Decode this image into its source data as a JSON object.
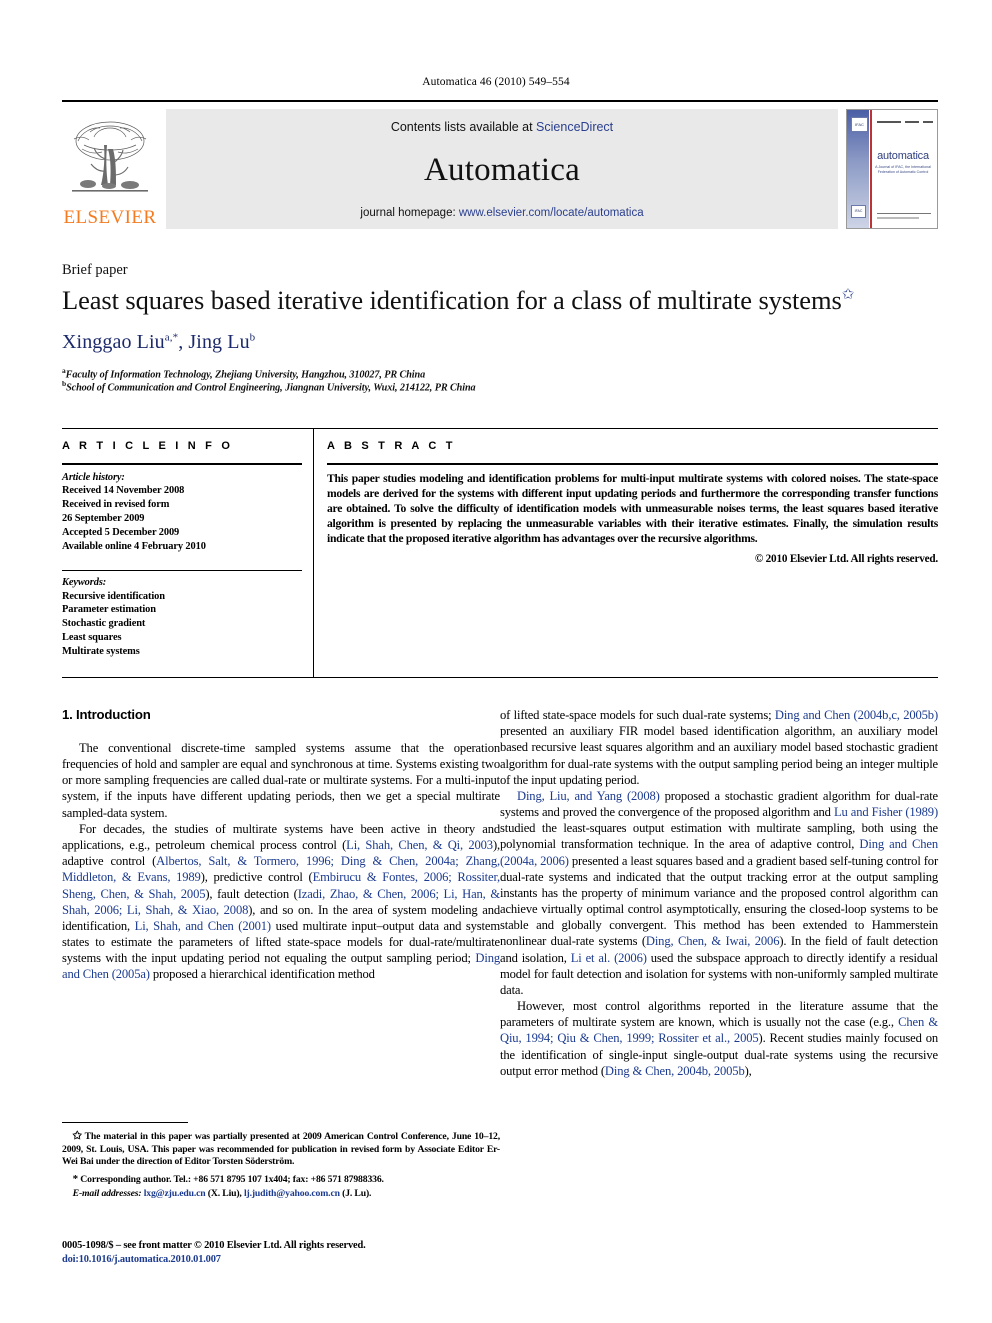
{
  "running_head": "Automatica 46 (2010) 549–554",
  "masthead": {
    "contents_prefix": "Contents lists available at ",
    "contents_link": "ScienceDirect",
    "journal_name": "Automatica",
    "homepage_prefix": "journal homepage: ",
    "homepage_link": "www.elsevier.com/locate/automatica",
    "publisher": "ELSEVIER",
    "cover": {
      "title": "automatica",
      "subtitle": "A Journal of IFAC, the International Federation of Automatic Control",
      "badge": "IFAC",
      "badge2": "IFAC"
    }
  },
  "article": {
    "type": "Brief paper",
    "title": "Least squares based iterative identification for a class of multirate systems",
    "title_footnote_marker": "✩",
    "authors": "Xinggao Liu",
    "author1_sup": "a,*",
    "author2_sep": ", ",
    "author2": "Jing Lu",
    "author2_sup": "b",
    "affiliations": [
      {
        "marker": "a",
        "text": "Faculty of Information Technology, Zhejiang University, Hangzhou, 310027, PR China"
      },
      {
        "marker": "b",
        "text": "School of Communication and Control Engineering, Jiangnan University, Wuxi, 214122, PR China"
      }
    ]
  },
  "info": {
    "heading": "A R T I C L E   I N F O",
    "history_label": "Article history:",
    "history": [
      "Received 14 November 2008",
      "Received in revised form",
      "26 September 2009",
      "Accepted 5 December 2009",
      "Available online 4 February 2010"
    ],
    "keywords_label": "Keywords:",
    "keywords": [
      "Recursive identification",
      "Parameter estimation",
      "Stochastic gradient",
      "Least squares",
      "Multirate systems"
    ]
  },
  "abstract": {
    "heading": "A B S T R A C T",
    "text": "This paper studies modeling and identification problems for multi-input multirate systems with colored noises. The state-space models are derived for the systems with different input updating periods and furthermore the corresponding transfer functions are obtained. To solve the difficulty of identification models with unmeasurable noises terms, the least squares based iterative algorithm is presented by replacing the unmeasurable variables with their iterative estimates. Finally, the simulation results indicate that the proposed iterative algorithm has advantages over the recursive algorithms.",
    "copyright": "© 2010 Elsevier Ltd. All rights reserved."
  },
  "body": {
    "section_number_title": "1. Introduction",
    "left": {
      "p1": "The conventional discrete-time sampled systems assume that the operation frequencies of hold and sampler are equal and synchronous at time. Systems existing two or more sampling frequencies are called dual-rate or multirate systems. For a multi-input system, if the inputs have different updating periods, then we get a special multirate sampled-data system.",
      "p2_a": "For decades, the studies of multirate systems have been active in theory and applications, e.g., petroleum chemical process control (",
      "p2_c1": "Li, Shah, Chen, & Qi, 2003",
      "p2_b": "), adaptive control (",
      "p2_c2": "Albertos, Salt, & Tormero, 1996; Ding & Chen, 2004a; Zhang, Middleton, & Evans, 1989",
      "p2_c": "), predictive control (",
      "p2_c3": "Embirucu & Fontes, 2006; Rossiter, Sheng, Chen, & Shah, 2005",
      "p2_d": "), fault detection (",
      "p2_c4": "Izadi, Zhao, & Chen, 2006; Li, Han, & Shah, 2006; Li, Shah, & Xiao, 2008",
      "p2_e": "), and so on. In the area of system modeling and identification, ",
      "p2_c5": "Li, Shah, and Chen (2001)",
      "p2_f": " used multirate input–output data and system states to estimate the parameters of lifted state-space models for dual-rate/multirate systems with the input updating period not equaling the output sampling period; ",
      "p2_c6": "Ding and Chen (2005a)",
      "p2_g": " proposed a hierarchical identification method"
    },
    "right": {
      "p2_h": "of lifted state-space models for such dual-rate systems; ",
      "p2_c7": "Ding and Chen (2004b,c, 2005b)",
      "p2_i": " presented an auxiliary FIR model based identification algorithm, an auxiliary model based recursive least squares algorithm and an auxiliary model based stochastic gradient algorithm for dual-rate systems with the output sampling period being an integer multiple of the input updating period.",
      "p3_c1": "Ding, Liu, and Yang (2008)",
      "p3_a": " proposed a stochastic gradient algorithm for dual-rate systems and proved the convergence of the proposed algorithm and ",
      "p3_c2": "Lu and Fisher (1989)",
      "p3_b": " studied the least-squares output estimation with multirate sampling, both using the polynomial transformation technique. In the area of adaptive control, ",
      "p3_c3": "Ding and Chen (2004a, 2006)",
      "p3_c": " presented a least squares based and a gradient based self-tuning control for dual-rate systems and indicated that the output tracking error at the output sampling instants has the property of minimum variance and the proposed control algorithm can achieve virtually optimal control asymptotically, ensuring the closed-loop systems to be stable and globally convergent. This method has been extended to Hammerstein nonlinear dual-rate systems (",
      "p3_c4": "Ding, Chen, & Iwai, 2006",
      "p3_d": "). In the field of fault detection and isolation, ",
      "p3_c5": "Li et al. (2006)",
      "p3_e": " used the subspace approach to directly identify a residual model for fault detection and isolation for systems with non-uniformly sampled multirate data.",
      "p4_a": "However, most control algorithms reported in the literature assume that the parameters of multirate system are known, which is usually not the case (e.g., ",
      "p4_c1": "Chen & Qiu, 1994; Qiu & Chen, 1999; Rossiter et al., 2005",
      "p4_b": "). Recent studies mainly focused on the identification of single-input single-output dual-rate systems using the recursive output error method (",
      "p4_c2": "Ding & Chen, 2004b, 2005b",
      "p4_c": "),"
    }
  },
  "footnotes": {
    "star_marker": "✩",
    "star_text": "The material in this paper was partially presented at 2009 American Control Conference, June 10–12, 2009, St. Louis, USA. This paper was recommended for publication in revised form by Associate Editor Er-Wei Bai under the direction of Editor Torsten Söderström.",
    "corr_marker": "*",
    "corr_text": "Corresponding author. Tel.: +86 571 8795 107 1x404; fax: +86 571 87988336.",
    "email_label": "E-mail addresses:",
    "email1": "lxg@zju.edu.cn",
    "email1_who": " (X. Liu), ",
    "email2": "lj.judith@yahoo.com.cn",
    "email2_who": " (J. Lu)."
  },
  "imprint": {
    "line1": "0005-1098/$ – see front matter © 2010 Elsevier Ltd. All rights reserved.",
    "doi": "doi:10.1016/j.automatica.2010.01.007"
  }
}
